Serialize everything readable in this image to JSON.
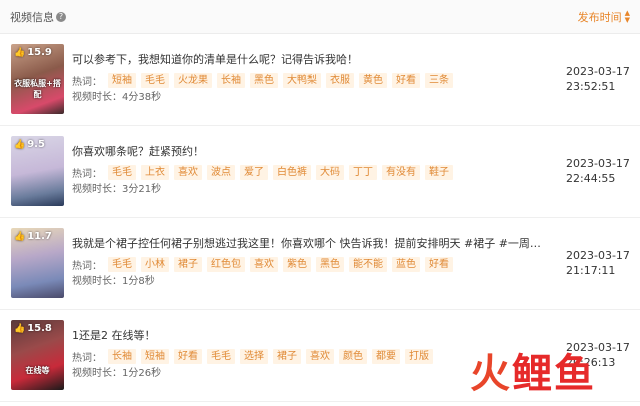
{
  "header": {
    "title": "视频信息",
    "help_icon": "question-circle-icon",
    "sort_label": "发布时间",
    "sort_icon": "sort-caret-icon"
  },
  "hot_label": "热词：",
  "duration_label": "视频时长：",
  "rows": [
    {
      "likes": "15.9",
      "title": "可以参考下，我想知道你的清单是什么呢？记得告诉我哈！",
      "tags": [
        "短袖",
        "毛毛",
        "火龙果",
        "长袖",
        "黑色",
        "大鸭梨",
        "衣服",
        "黄色",
        "好看",
        "三条"
      ],
      "duration": "4分38秒",
      "date": "2023-03-17",
      "time": "23:52:51",
      "thumb_overlay": "衣服私服+搭配"
    },
    {
      "likes": "9.5",
      "title": "你喜欢哪条呢？赶紧预约！",
      "tags": [
        "毛毛",
        "上衣",
        "喜欢",
        "波点",
        "爱了",
        "白色裤",
        "大码",
        "丁丁",
        "有没有",
        "鞋子"
      ],
      "duration": "3分21秒",
      "date": "2023-03-17",
      "time": "22:44:55",
      "thumb_overlay": ""
    },
    {
      "likes": "11.7",
      "title": "我就是个裙子控任何裙子别想逃过我这里！你喜欢哪个 快告诉我！提前安排明天 #裙子 #一周穿搭不...",
      "tags": [
        "毛毛",
        "小林",
        "裙子",
        "红色包",
        "喜欢",
        "紫色",
        "黑色",
        "能不能",
        "蓝色",
        "好看"
      ],
      "duration": "1分8秒",
      "date": "2023-03-17",
      "time": "21:17:11",
      "thumb_overlay": ""
    },
    {
      "likes": "15.8",
      "title": "1还是2 在线等！",
      "tags": [
        "长袖",
        "短袖",
        "好看",
        "毛毛",
        "选择",
        "裙子",
        "喜欢",
        "颜色",
        "都要",
        "打版"
      ],
      "duration": "1分26秒",
      "date": "2023-03-17",
      "time": "20:26:13",
      "thumb_overlay": "在线等"
    }
  ],
  "watermark": "火鲤鱼"
}
